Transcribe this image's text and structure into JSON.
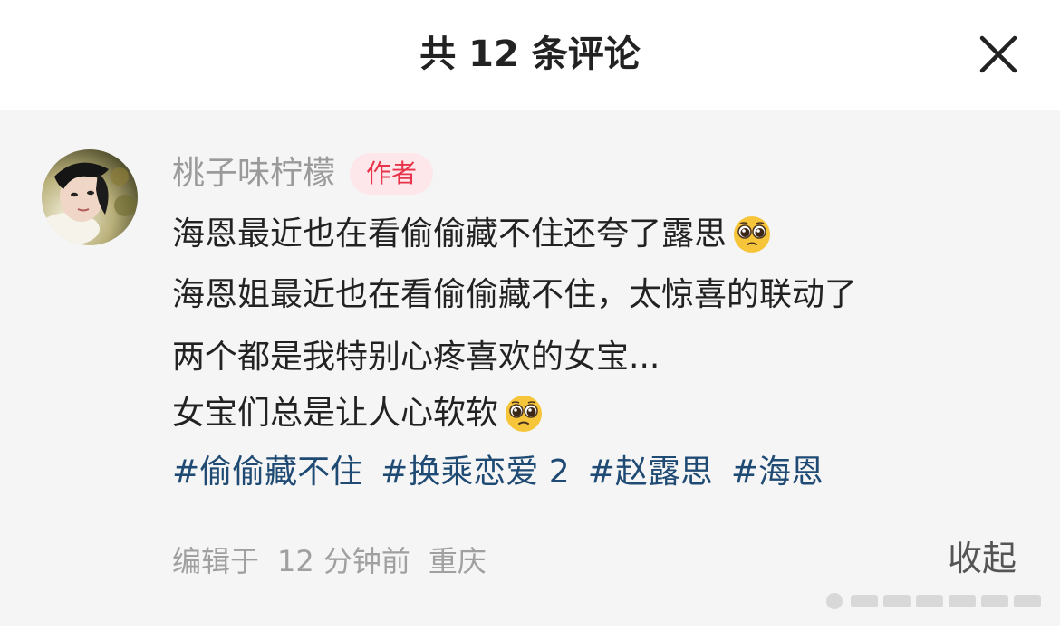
{
  "header": {
    "title": "共 12 条评论",
    "close_icon": "close-icon"
  },
  "comment": {
    "author": "桃子味柠檬",
    "badge": "作者",
    "lines": [
      "海恩最近也在看偷偷藏不住还夸了露思",
      "海恩姐最近也在看偷偷藏不住，太惊喜的联动了",
      "两个都是我特别心疼喜欢的女宝...",
      "女宝们总是让人心软软"
    ],
    "emoji_name": "pleading-face-emoji",
    "tags": [
      "#偷偷藏不住",
      "#换乘恋爱 2",
      "#赵露思",
      "#海恩"
    ],
    "meta": {
      "edited": "编辑于",
      "time": "12 分钟前",
      "location": "重庆"
    },
    "collapse_label": "收起"
  },
  "colors": {
    "badge_bg": "#fde7ea",
    "badge_text": "#e8344a",
    "tag_text": "#1f4a73",
    "card_bg": "#f5f5f5"
  }
}
